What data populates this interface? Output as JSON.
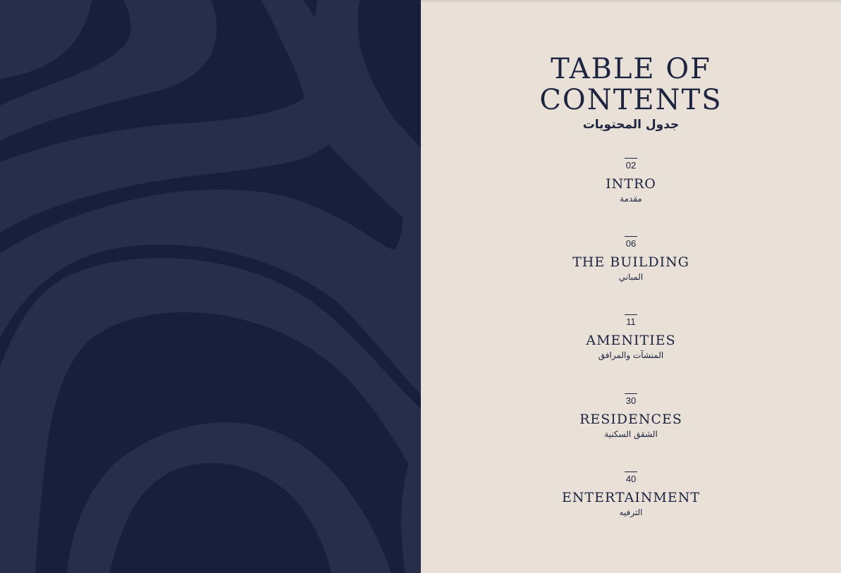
{
  "colors": {
    "navy": "#181f3a",
    "navy_light": "#272e4a",
    "cream": "#e9e0d8",
    "ink": "#1d2440"
  },
  "toc": {
    "title_line1": "TABLE OF",
    "title_line2": "CONTENTS",
    "title_ar": "جدول المحتويات",
    "entries": [
      {
        "page": "02",
        "title": "INTRO",
        "title_ar": "مقدمة"
      },
      {
        "page": "06",
        "title": "THE BUILDING",
        "title_ar": "المباني"
      },
      {
        "page": "11",
        "title": "AMENITIES",
        "title_ar": "المنشآت والمرافق"
      },
      {
        "page": "30",
        "title": "RESIDENCES",
        "title_ar": "الشقق السكنية"
      },
      {
        "page": "40",
        "title": "ENTERTAINMENT",
        "title_ar": "الترفيه"
      }
    ]
  }
}
